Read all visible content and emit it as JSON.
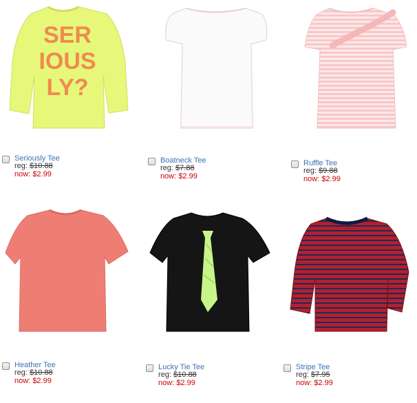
{
  "products": [
    {
      "name": "Seriously Tee",
      "reg_label": "reg:",
      "reg_price": "$10.88",
      "now_label": "now:",
      "now_price": "$2.99",
      "shirt_text": [
        "SER",
        "IOUS",
        "LY?"
      ],
      "color": "#e6f77a"
    },
    {
      "name": "Boatneck Tee",
      "reg_label": "reg:",
      "reg_price": "$7.88",
      "now_label": "now:",
      "now_price": "$2.99",
      "color": "#fbfafa"
    },
    {
      "name": "Ruffle Tee",
      "reg_label": "reg:",
      "reg_price": "$9.88",
      "now_label": "now:",
      "now_price": "$2.99",
      "color": "#f8d6d6"
    },
    {
      "name": "Heather Tee",
      "reg_label": "reg:",
      "reg_price": "$10.88",
      "now_label": "now:",
      "now_price": "$2.99",
      "color": "#ee7e74"
    },
    {
      "name": "Lucky Tie Tee",
      "reg_label": "reg:",
      "reg_price": "$10.88",
      "now_label": "now:",
      "now_price": "$2.99",
      "color": "#151515"
    },
    {
      "name": "Stripe Tee",
      "reg_label": "reg:",
      "reg_price": "$7.95",
      "now_label": "now:",
      "now_price": "$2.99",
      "color": "#b3202b"
    }
  ]
}
